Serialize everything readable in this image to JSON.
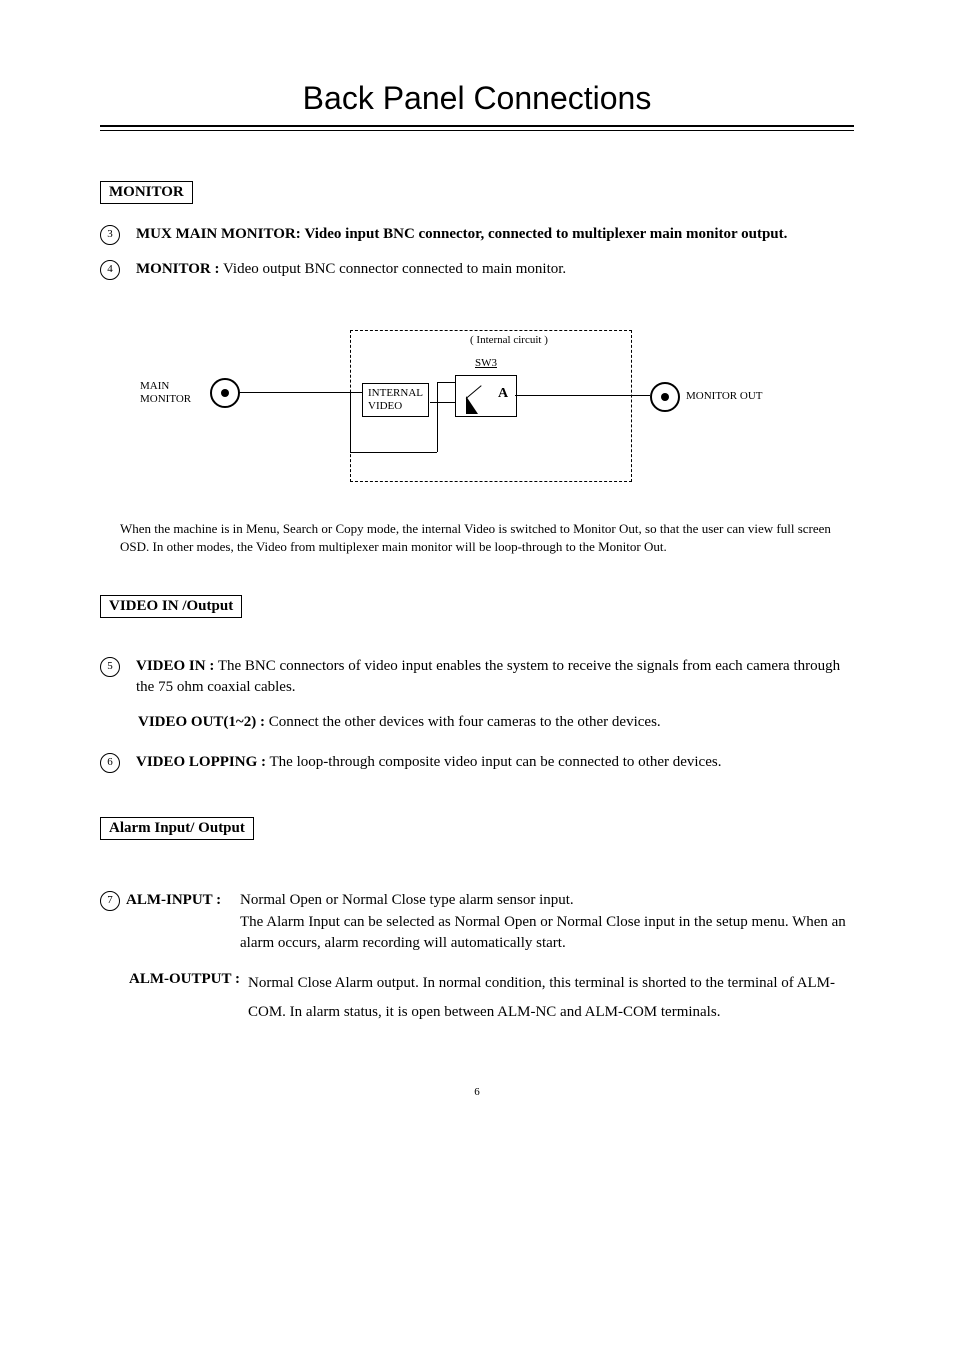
{
  "title": "Back Panel Connections",
  "sections": {
    "monitor": {
      "heading": "MONITOR",
      "item3": {
        "num": "3",
        "label": "MUX MAIN MONITOR:",
        "desc": "Video input BNC connector, connected to multiplexer main monitor output."
      },
      "item4": {
        "num": "4",
        "label": "MONITOR :",
        "desc": "Video output BNC connector connected to main monitor."
      }
    },
    "diagram": {
      "main_monitor_l1": "MAIN",
      "main_monitor_l2": "MONITOR",
      "internal_circuit": "( Internal circuit )",
      "sw3": "SW3",
      "internal_video_l1": "INTERNAL",
      "internal_video_l2": "VIDEO",
      "a": "A",
      "monitor_out": "MONITOR OUT"
    },
    "note": "When the machine is in Menu, Search or Copy mode, the internal Video is switched to Monitor Out, so that the user can view full screen OSD.  In other modes, the Video from multiplexer main monitor will be loop-through to the Monitor Out.",
    "video": {
      "heading": "VIDEO  IN /Output",
      "item5": {
        "num": "5",
        "label": "VIDEO IN :",
        "desc": "The BNC connectors of video input enables the system to receive the signals from each camera through the 75 ohm coaxial cables."
      },
      "video_out": {
        "label": "VIDEO OUT(1~2) :",
        "desc": "Connect the other devices with four cameras to the other devices."
      },
      "item6": {
        "num": "6",
        "label": "VIDEO LOPPING :",
        "desc": "The loop-through composite video input can be connected to other devices."
      }
    },
    "alarm": {
      "heading": "Alarm Input/ Output",
      "item7_num": "7",
      "alm_input": {
        "label": "ALM-INPUT :",
        "desc": "Normal Open or Normal Close type alarm sensor input.\nThe Alarm Input can be selected as Normal Open or Normal Close input in the setup menu. When an alarm occurs, alarm recording will automatically start."
      },
      "alm_output": {
        "label": "ALM-OUTPUT :",
        "desc": "Normal Close Alarm output. In normal condition, this terminal is shorted to the terminal of ALM-COM. In alarm status, it is open between ALM-NC and ALM-COM terminals."
      }
    }
  },
  "page_number": "6"
}
